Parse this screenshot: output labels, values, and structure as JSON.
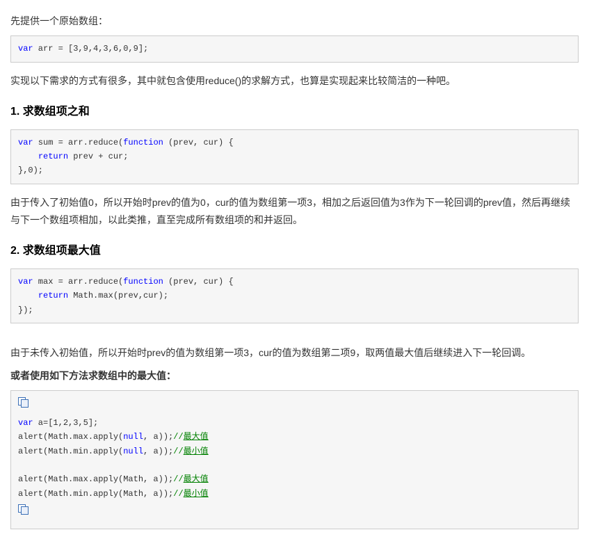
{
  "p1": "先提供一个原始数组：",
  "code1": "var arr = [3,9,4,3,6,0,9];",
  "code1_kw": "var",
  "code1_rest": " arr = [3,9,4,3,6,0,9];",
  "p2": "实现以下需求的方式有很多，其中就包含使用reduce()的求解方式，也算是实现起来比较简洁的一种吧。",
  "h1": "1. 求数组项之和",
  "code2_l1_a": "var",
  "code2_l1_b": " sum = arr.reduce(",
  "code2_l1_c": "function",
  "code2_l1_d": " (prev, cur) {",
  "code2_l2_a": "    ",
  "code2_l2_b": "return",
  "code2_l2_c": " prev + cur;",
  "code2_l3": "},0);",
  "p3": "由于传入了初始值0，所以开始时prev的值为0，cur的值为数组第一项3，相加之后返回值为3作为下一轮回调的prev值，然后再继续与下一个数组项相加，以此类推，直至完成所有数组项的和并返回。",
  "h2": "2. 求数组项最大值",
  "code3_l1_a": "var",
  "code3_l1_b": " max = arr.reduce(",
  "code3_l1_c": "function",
  "code3_l1_d": " (prev, cur) {",
  "code3_l2_a": "    ",
  "code3_l2_b": "return",
  "code3_l2_c": " Math.max(prev,cur);",
  "code3_l3": "});",
  "p4": "由于未传入初始值，所以开始时prev的值为数组第一项3，cur的值为数组第二项9，取两值最大值后继续进入下一轮回调。",
  "p5": "或者使用如下方法求数组中的最大值：",
  "code4_l1_a": "var",
  "code4_l1_b": " a=[1,2,3,5];",
  "code4_l2_a": "alert(Math.max.apply(",
  "code4_l2_b": "null",
  "code4_l2_c": ", a));",
  "code4_l2_d": "//",
  "code4_l2_e": "最大值",
  "code4_l3_a": "alert(Math.min.apply(",
  "code4_l3_b": "null",
  "code4_l3_c": ", a));",
  "code4_l3_d": "//",
  "code4_l3_e": "最小值",
  "code4_l5_a": "alert(Math.max.apply(Math, a));",
  "code4_l5_b": "//",
  "code4_l5_c": "最大值",
  "code4_l6_a": "alert(Math.min.apply(Math, a));",
  "code4_l6_b": "//",
  "code4_l6_c": "最小值"
}
